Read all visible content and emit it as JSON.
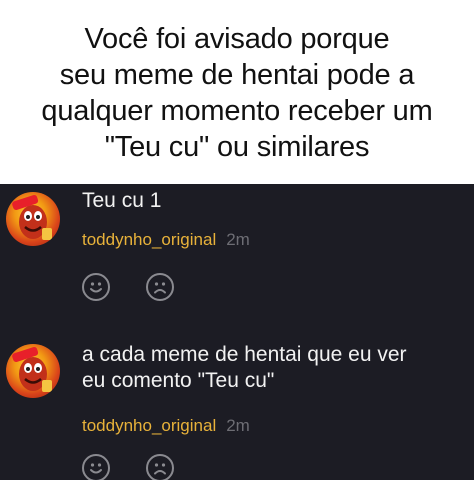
{
  "caption": {
    "line1": "Você foi avisado porque",
    "line2": "seu meme de hentai pode a",
    "line3": "qualquer momento receber um",
    "line4": "\"Teu cu\" ou similares"
  },
  "comments": [
    {
      "text_line1": "Teu cu 1",
      "text_line2": "",
      "username": "toddynho_original",
      "time": "2m",
      "like_icon": "smile-face-icon",
      "dislike_icon": "sad-face-icon"
    },
    {
      "text_line1": "a cada meme de hentai que eu ver",
      "text_line2": "eu comento \"Teu cu\"",
      "username": "toddynho_original",
      "time": "2m",
      "like_icon": "smile-face-icon",
      "dislike_icon": "sad-face-icon"
    }
  ],
  "colors": {
    "panel_bg": "#1c1c24",
    "username": "#e8b23a",
    "timestamp": "#6d6d74",
    "comment_text": "#f2f2f2"
  }
}
